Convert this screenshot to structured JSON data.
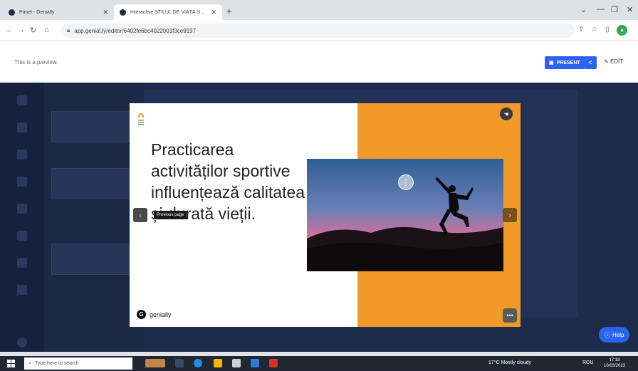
{
  "browser": {
    "tabs": [
      {
        "title": "Panel - Genially",
        "active": false
      },
      {
        "title": "Interactive STILUL DE VIAȚĂ SĂNĂT...",
        "active": true
      }
    ],
    "url": "app.genial.ly/editor/6402fe6bc4022001f3ce9197"
  },
  "preview": {
    "label": "This is a preview.",
    "present_label": "PRESENT",
    "edit_label": "EDIT"
  },
  "slide": {
    "text": "Practicarea activităților sportive influențează calitatea și durată vieții.",
    "brand": "genially",
    "prev_tooltip": "Previous page"
  },
  "editor": {
    "help_label": "Help"
  },
  "taskbar": {
    "search_placeholder": "Type here to search",
    "weather": "17°C  Mostly cloudy",
    "lang": "ROU",
    "time": "17:18",
    "date": "10/03/2023"
  },
  "colors": {
    "slide_accent": "#f29a27",
    "editor_bg": "#1d2b4a",
    "primary_button": "#2a63f0"
  }
}
